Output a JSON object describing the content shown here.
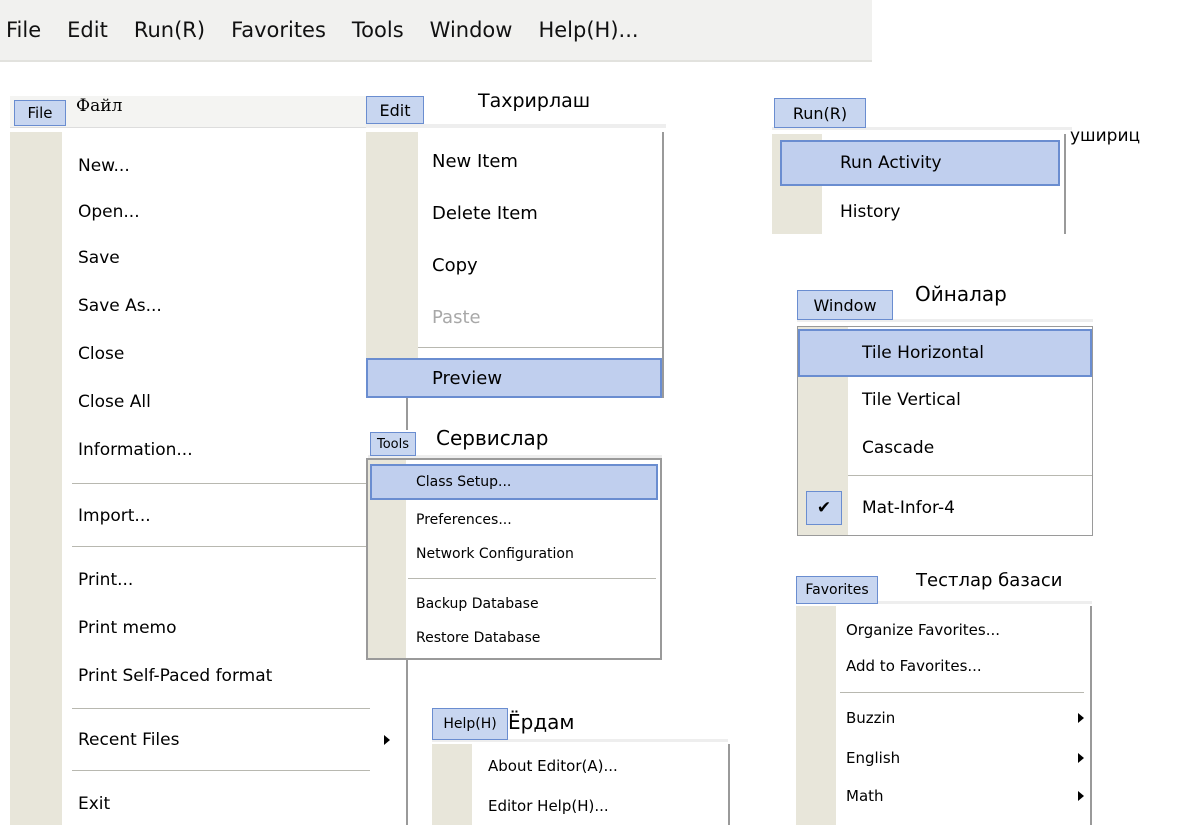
{
  "menubar": [
    "File",
    "Edit",
    "Run(R)",
    "Favorites",
    "Tools",
    "Window",
    "Help(H)..."
  ],
  "file_menu": {
    "button": "File",
    "caption": "Файл",
    "items": [
      "New...",
      "Open...",
      "Save",
      "Save As...",
      "Close",
      "Close All",
      "Information...",
      "Import...",
      "Print...",
      "Print memo",
      "Print Self-Paced format",
      "Recent Files",
      "Exit"
    ]
  },
  "edit_menu": {
    "button": "Edit",
    "caption": "Тахрирлаш",
    "items": [
      "New Item",
      "Delete Item",
      "Copy",
      "Paste",
      "Preview"
    ]
  },
  "run_menu": {
    "button": "Run(R)",
    "caption": "ушириц",
    "items": [
      "Run Activity",
      "History"
    ]
  },
  "window_menu": {
    "button": "Window",
    "caption": "Ойналар",
    "items": [
      "Tile Horizontal",
      "Tile Vertical",
      "Cascade",
      "Mat-Infor-4"
    ]
  },
  "tools_menu": {
    "button": "Tools",
    "caption": "Сервислар",
    "items": [
      "Class Setup...",
      "Preferences...",
      "Network Configuration",
      "Backup Database",
      "Restore Database"
    ]
  },
  "favorites_menu": {
    "button": "Favorites",
    "caption": "Тестлар базаси",
    "items": [
      "Organize Favorites...",
      "Add to Favorites...",
      "Buzzin",
      "English",
      "Math"
    ]
  },
  "help_menu": {
    "button": "Help(H)",
    "caption": "Ёрдам",
    "items": [
      "About Editor(A)...",
      "Editor Help(H)..."
    ]
  },
  "colors": {
    "highlight": "#c0cfee",
    "highlight_border": "#6a8dd0",
    "strip": "#e8e6da"
  }
}
